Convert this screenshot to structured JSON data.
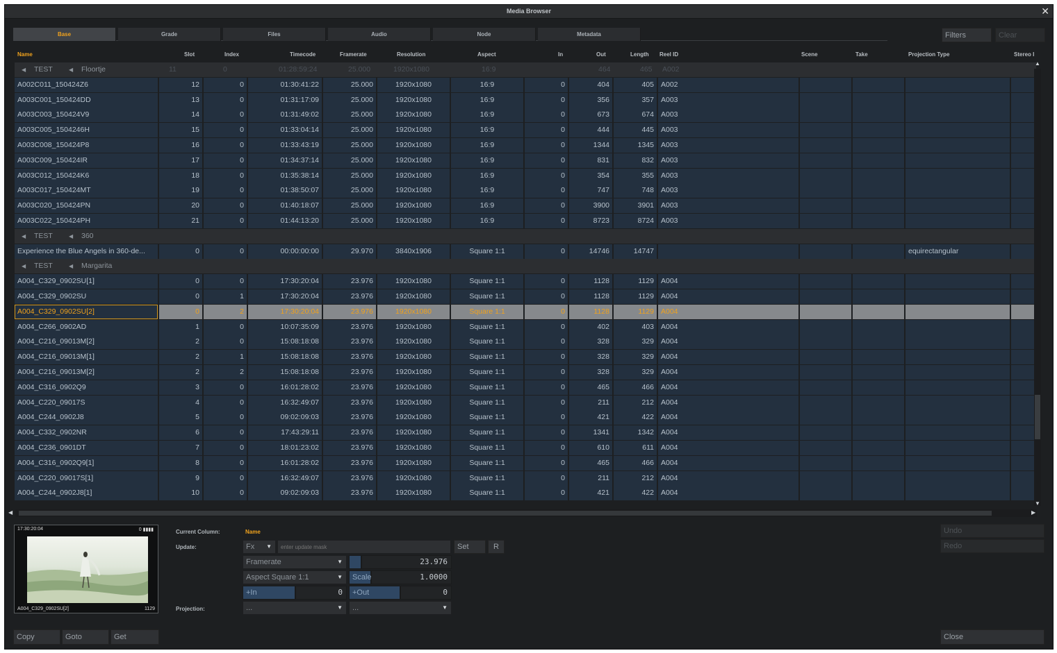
{
  "window": {
    "title": "Media Browser",
    "close_glyph": "✕"
  },
  "tabs": [
    {
      "label": "Base",
      "active": true
    },
    {
      "label": "Grade",
      "active": false
    },
    {
      "label": "Files",
      "active": false
    },
    {
      "label": "Audio",
      "active": false
    },
    {
      "label": "Node",
      "active": false
    },
    {
      "label": "Metadata",
      "active": false
    }
  ],
  "top_buttons": {
    "filters": "Filters",
    "clear": "Clear"
  },
  "columns": [
    "Name",
    "Slot",
    "Index",
    "Timecode",
    "Framerate",
    "Resolution",
    "Aspect",
    "In",
    "Out",
    "Length",
    "Reel ID",
    "Scene",
    "Take",
    "Projection Type",
    "Stereo I"
  ],
  "rows": [
    {
      "kind": "group",
      "parts": [
        "TEST",
        "Floortje"
      ],
      "ghost": [
        "11",
        "0",
        "01:28:59:24",
        "25.000",
        "1920x1080",
        "16:9",
        "464",
        "465",
        "A002"
      ]
    },
    {
      "name": "A002C011_150424Z6",
      "slot": "12",
      "index": "0",
      "tc": "01:30:41:22",
      "fr": "25.000",
      "res": "1920x1080",
      "aspect": "16:9",
      "in": "0",
      "out": "404",
      "len": "405",
      "reel": "A002",
      "proj": ""
    },
    {
      "name": "A003C001_150424DD",
      "slot": "13",
      "index": "0",
      "tc": "01:31:17:09",
      "fr": "25.000",
      "res": "1920x1080",
      "aspect": "16:9",
      "in": "0",
      "out": "356",
      "len": "357",
      "reel": "A003",
      "proj": ""
    },
    {
      "name": "A003C003_150424V9",
      "slot": "14",
      "index": "0",
      "tc": "01:31:49:02",
      "fr": "25.000",
      "res": "1920x1080",
      "aspect": "16:9",
      "in": "0",
      "out": "673",
      "len": "674",
      "reel": "A003",
      "proj": ""
    },
    {
      "name": "A003C005_1504246H",
      "slot": "15",
      "index": "0",
      "tc": "01:33:04:14",
      "fr": "25.000",
      "res": "1920x1080",
      "aspect": "16:9",
      "in": "0",
      "out": "444",
      "len": "445",
      "reel": "A003",
      "proj": ""
    },
    {
      "name": "A003C008_150424P8",
      "slot": "16",
      "index": "0",
      "tc": "01:33:43:19",
      "fr": "25.000",
      "res": "1920x1080",
      "aspect": "16:9",
      "in": "0",
      "out": "1344",
      "len": "1345",
      "reel": "A003",
      "proj": ""
    },
    {
      "name": "A003C009_150424IR",
      "slot": "17",
      "index": "0",
      "tc": "01:34:37:14",
      "fr": "25.000",
      "res": "1920x1080",
      "aspect": "16:9",
      "in": "0",
      "out": "831",
      "len": "832",
      "reel": "A003",
      "proj": ""
    },
    {
      "name": "A003C012_150424K6",
      "slot": "18",
      "index": "0",
      "tc": "01:35:38:14",
      "fr": "25.000",
      "res": "1920x1080",
      "aspect": "16:9",
      "in": "0",
      "out": "354",
      "len": "355",
      "reel": "A003",
      "proj": ""
    },
    {
      "name": "A003C017_150424MT",
      "slot": "19",
      "index": "0",
      "tc": "01:38:50:07",
      "fr": "25.000",
      "res": "1920x1080",
      "aspect": "16:9",
      "in": "0",
      "out": "747",
      "len": "748",
      "reel": "A003",
      "proj": ""
    },
    {
      "name": "A003C020_150424PN",
      "slot": "20",
      "index": "0",
      "tc": "01:40:18:07",
      "fr": "25.000",
      "res": "1920x1080",
      "aspect": "16:9",
      "in": "0",
      "out": "3900",
      "len": "3901",
      "reel": "A003",
      "proj": ""
    },
    {
      "name": "A003C022_150424PH",
      "slot": "21",
      "index": "0",
      "tc": "01:44:13:20",
      "fr": "25.000",
      "res": "1920x1080",
      "aspect": "16:9",
      "in": "0",
      "out": "8723",
      "len": "8724",
      "reel": "A003",
      "proj": ""
    },
    {
      "kind": "group",
      "parts": [
        "TEST",
        "360"
      ]
    },
    {
      "name": "Experience the Blue Angels in 360-de...",
      "slot": "0",
      "index": "0",
      "tc": "00:00:00:00",
      "fr": "29.970",
      "res": "3840x1906",
      "aspect": "Square 1:1",
      "in": "0",
      "out": "14746",
      "len": "14747",
      "reel": "",
      "proj": "equirectangular"
    },
    {
      "kind": "group",
      "parts": [
        "TEST",
        "Margarita"
      ]
    },
    {
      "name": "A004_C329_0902SU[1]",
      "slot": "0",
      "index": "0",
      "tc": "17:30:20:04",
      "fr": "23.976",
      "res": "1920x1080",
      "aspect": "Square 1:1",
      "in": "0",
      "out": "1128",
      "len": "1129",
      "reel": "A004",
      "proj": ""
    },
    {
      "name": "A004_C329_0902SU",
      "slot": "0",
      "index": "1",
      "tc": "17:30:20:04",
      "fr": "23.976",
      "res": "1920x1080",
      "aspect": "Square 1:1",
      "in": "0",
      "out": "1128",
      "len": "1129",
      "reel": "A004",
      "proj": ""
    },
    {
      "name": "A004_C329_0902SU[2]",
      "slot": "0",
      "index": "2",
      "tc": "17:30:20:04",
      "fr": "23.976",
      "res": "1920x1080",
      "aspect": "Square 1:1",
      "in": "0",
      "out": "1128",
      "len": "1129",
      "reel": "A004",
      "proj": "",
      "selected": true
    },
    {
      "name": "A004_C266_0902AD",
      "slot": "1",
      "index": "0",
      "tc": "10:07:35:09",
      "fr": "23.976",
      "res": "1920x1080",
      "aspect": "Square 1:1",
      "in": "0",
      "out": "402",
      "len": "403",
      "reel": "A004",
      "proj": ""
    },
    {
      "name": "A004_C216_09013M[2]",
      "slot": "2",
      "index": "0",
      "tc": "15:08:18:08",
      "fr": "23.976",
      "res": "1920x1080",
      "aspect": "Square 1:1",
      "in": "0",
      "out": "328",
      "len": "329",
      "reel": "A004",
      "proj": ""
    },
    {
      "name": "A004_C216_09013M[1]",
      "slot": "2",
      "index": "1",
      "tc": "15:08:18:08",
      "fr": "23.976",
      "res": "1920x1080",
      "aspect": "Square 1:1",
      "in": "0",
      "out": "328",
      "len": "329",
      "reel": "A004",
      "proj": ""
    },
    {
      "name": "A004_C216_09013M[2]",
      "slot": "2",
      "index": "2",
      "tc": "15:08:18:08",
      "fr": "23.976",
      "res": "1920x1080",
      "aspect": "Square 1:1",
      "in": "0",
      "out": "328",
      "len": "329",
      "reel": "A004",
      "proj": ""
    },
    {
      "name": "A004_C316_0902Q9",
      "slot": "3",
      "index": "0",
      "tc": "16:01:28:02",
      "fr": "23.976",
      "res": "1920x1080",
      "aspect": "Square 1:1",
      "in": "0",
      "out": "465",
      "len": "466",
      "reel": "A004",
      "proj": ""
    },
    {
      "name": "A004_C220_09017S",
      "slot": "4",
      "index": "0",
      "tc": "16:32:49:07",
      "fr": "23.976",
      "res": "1920x1080",
      "aspect": "Square 1:1",
      "in": "0",
      "out": "211",
      "len": "212",
      "reel": "A004",
      "proj": ""
    },
    {
      "name": "A004_C244_0902J8",
      "slot": "5",
      "index": "0",
      "tc": "09:02:09:03",
      "fr": "23.976",
      "res": "1920x1080",
      "aspect": "Square 1:1",
      "in": "0",
      "out": "421",
      "len": "422",
      "reel": "A004",
      "proj": ""
    },
    {
      "name": "A004_C332_0902NR",
      "slot": "6",
      "index": "0",
      "tc": "17:43:29:11",
      "fr": "23.976",
      "res": "1920x1080",
      "aspect": "Square 1:1",
      "in": "0",
      "out": "1341",
      "len": "1342",
      "reel": "A004",
      "proj": ""
    },
    {
      "name": "A004_C236_0901DT",
      "slot": "7",
      "index": "0",
      "tc": "18:01:23:02",
      "fr": "23.976",
      "res": "1920x1080",
      "aspect": "Square 1:1",
      "in": "0",
      "out": "610",
      "len": "611",
      "reel": "A004",
      "proj": ""
    },
    {
      "name": "A004_C316_0902Q9[1]",
      "slot": "8",
      "index": "0",
      "tc": "16:01:28:02",
      "fr": "23.976",
      "res": "1920x1080",
      "aspect": "Square 1:1",
      "in": "0",
      "out": "465",
      "len": "466",
      "reel": "A004",
      "proj": ""
    },
    {
      "name": "A004_C220_09017S[1]",
      "slot": "9",
      "index": "0",
      "tc": "16:32:49:07",
      "fr": "23.976",
      "res": "1920x1080",
      "aspect": "Square 1:1",
      "in": "0",
      "out": "211",
      "len": "212",
      "reel": "A004",
      "proj": ""
    },
    {
      "name": "A004_C244_0902J8[1]",
      "slot": "10",
      "index": "0",
      "tc": "09:02:09:03",
      "fr": "23.976",
      "res": "1920x1080",
      "aspect": "Square 1:1",
      "in": "0",
      "out": "421",
      "len": "422",
      "reel": "A004",
      "proj": ""
    }
  ],
  "preview": {
    "timecode": "17:30:20:04",
    "level_text": "0 ▮▮▮▮",
    "caption": "A004_C329_0902SU[2]",
    "frame": "1129"
  },
  "editor": {
    "current_column_label": "Current Column:",
    "current_column_value": "Name",
    "update_label": "Update:",
    "fx_value": "Fx",
    "update_placeholder": "enter update mask",
    "set_button": "Set",
    "r_button": "R",
    "framerate_select": "Framerate",
    "framerate_value": "23.976",
    "aspect_select": "Aspect Square 1:1",
    "scale_label": "Scale",
    "scale_value": "1.0000",
    "in_label": "+In",
    "in_value": "0",
    "out_label": "+Out",
    "out_value": "0",
    "projection_label": "Projection:",
    "projection_a": "...",
    "projection_b": "..."
  },
  "side_buttons": {
    "undo": "Undo",
    "redo": "Redo"
  },
  "bottom_buttons": {
    "copy": "Copy",
    "goto": "Goto",
    "get": "Get",
    "close": "Close"
  },
  "icons": {
    "close": "close-icon",
    "dropdown": "chevron-down-icon",
    "scroll_up": "arrow-up-icon",
    "scroll_down": "arrow-down-icon",
    "scroll_left": "arrow-left-icon",
    "scroll_right": "arrow-right-icon",
    "group_expander": "triangle-left-icon"
  }
}
